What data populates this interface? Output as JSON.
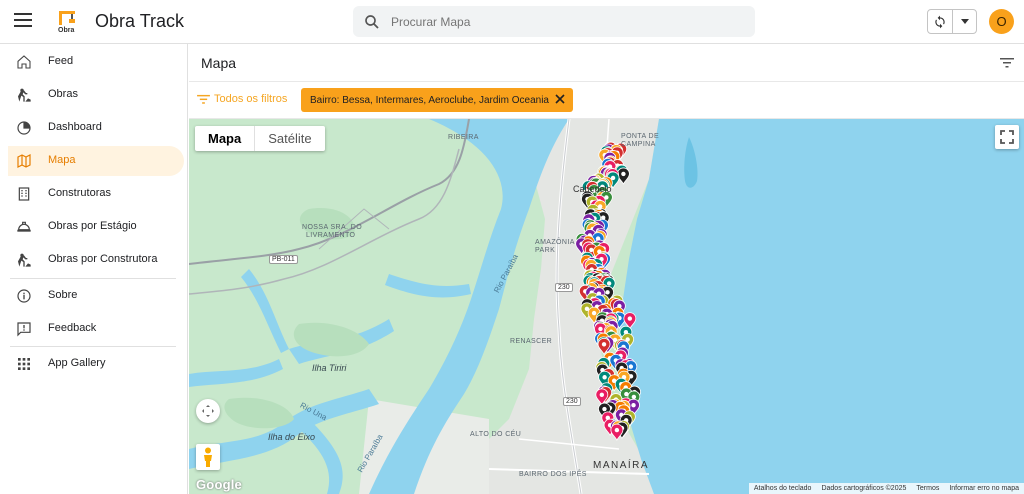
{
  "app": {
    "title": "Obra Track",
    "logo_text": "Obra",
    "user_initial": "O"
  },
  "search": {
    "placeholder": "Procurar Mapa"
  },
  "sidebar": {
    "items": [
      {
        "label": "Feed",
        "icon": "home-icon"
      },
      {
        "label": "Obras",
        "icon": "worker-icon"
      },
      {
        "label": "Dashboard",
        "icon": "pie-chart-icon"
      },
      {
        "label": "Mapa",
        "icon": "map-icon",
        "active": true
      },
      {
        "label": "Construtoras",
        "icon": "building-icon"
      },
      {
        "label": "Obras por Estágio",
        "icon": "hard-hat-icon"
      },
      {
        "label": "Obras por Construtora",
        "icon": "worker-icon"
      },
      {
        "label": "Sobre",
        "icon": "info-icon"
      },
      {
        "label": "Feedback",
        "icon": "feedback-icon"
      },
      {
        "label": "App Gallery",
        "icon": "apps-grid-icon"
      }
    ]
  },
  "page": {
    "title": "Mapa",
    "all_filters_label": "Todos os filtros",
    "filter_chip": "Bairro: Bessa, Intermares, Aeroclube, Jardim Oceania"
  },
  "map": {
    "type_map": "Mapa",
    "type_satellite": "Satélite",
    "google": "Google",
    "attribution": [
      "Atalhos do teclado",
      "Dados cartográficos ©2025",
      "Termos",
      "Informar erro no mapa"
    ],
    "labels": {
      "ribeira": "RIBEIRA",
      "ponta_de": "PONTA DE",
      "campina": "CAMPINA",
      "cabedelo": "Cabedelo",
      "amazonia": "AMAZÔNIA",
      "park": "PARK",
      "nossa_sra_1": "NOSSA SRA. DO",
      "nossa_sra_2": "LIVRAMENTO",
      "renascer": "RENASCER",
      "ilha_tiriri": "Ilha Tiriri",
      "ilha_eixo": "Ilha do Eixo",
      "alto_do_ceu": "ALTO DO CÉU",
      "bairro_ipes": "BAIRRO DOS IPÊS",
      "manaira": "MANAÍRA",
      "rio_paraiba_1": "Rio Paraíba",
      "rio_paraiba_2": "Rio Paraíba",
      "rio_una": "Rio Una",
      "pb011": "PB-011",
      "br230a": "230",
      "br230b": "230"
    },
    "colors": {
      "water": "#8fd3ee",
      "land": "#c8e8cc",
      "urban": "#e4e6e3",
      "accent": "#f9a11b",
      "marker_palette": [
        "#d32f2f",
        "#7b1fa2",
        "#f9a825",
        "#388e3c",
        "#1976d2",
        "#e91e63",
        "#f57c00",
        "#212121",
        "#afb42b",
        "#00897b"
      ]
    }
  }
}
